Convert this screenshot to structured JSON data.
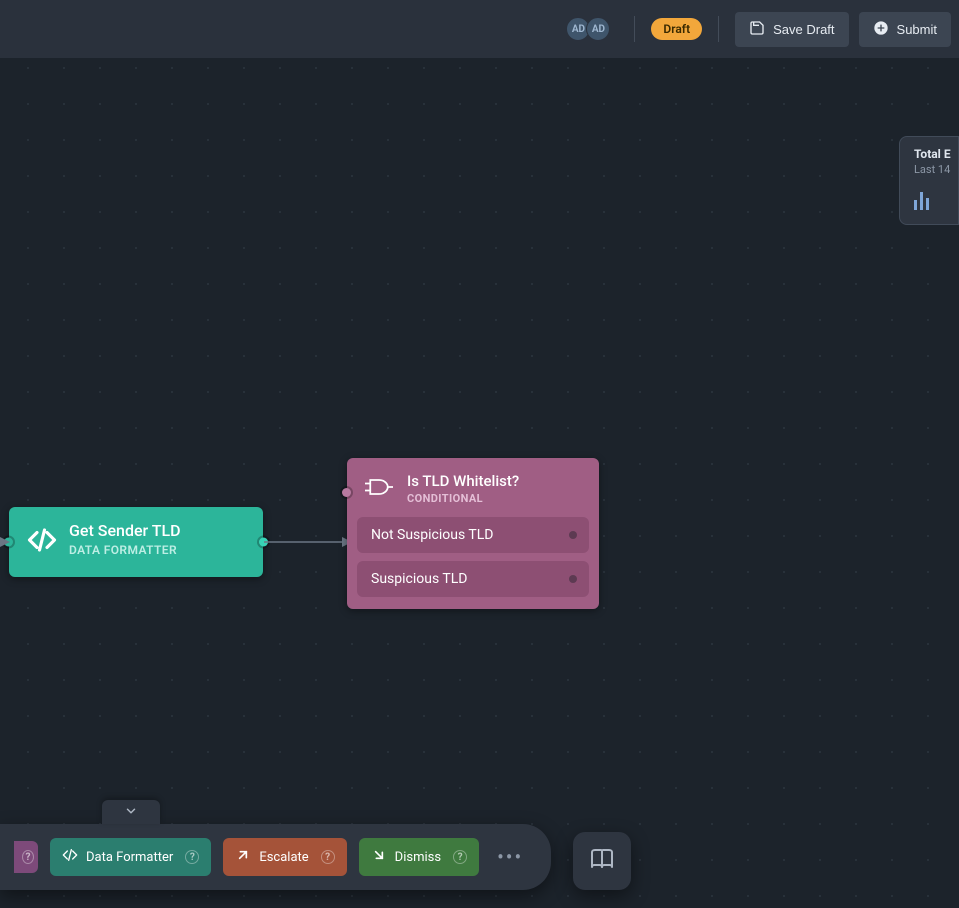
{
  "topbar": {
    "avatars": [
      "AD",
      "AD"
    ],
    "draft_chip": "Draft",
    "save_label": "Save Draft",
    "submit_label": "Submit"
  },
  "panel": {
    "title": "Total E",
    "subtitle": "Last 14"
  },
  "nodes": {
    "formatter": {
      "title": "Get Sender TLD",
      "subtitle": "DATA FORMATTER"
    },
    "conditional": {
      "title": "Is TLD Whitelist?",
      "subtitle": "CONDITIONAL",
      "branches": [
        "Not Suspicious TLD",
        "Suspicious TLD"
      ]
    }
  },
  "dock": {
    "data_formatter": "Data Formatter",
    "escalate": "Escalate",
    "dismiss": "Dismiss",
    "help": "?",
    "more": "•••"
  }
}
